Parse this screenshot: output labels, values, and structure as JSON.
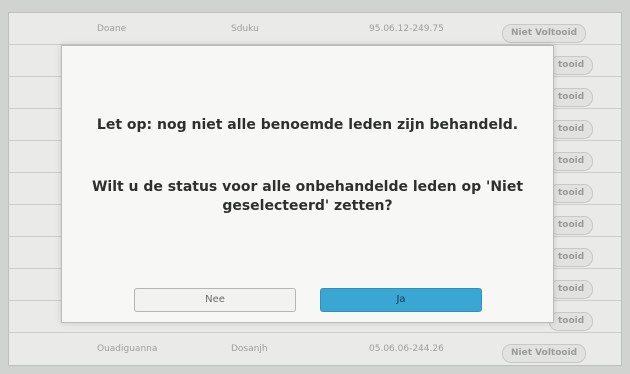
{
  "table": {
    "rows": [
      {
        "name": "Doane",
        "surname": "Sduku",
        "code": "95.06.12-249.75",
        "status": "Niet Voltooid"
      },
      {
        "name": "",
        "surname": "",
        "code": "",
        "status": "tooid"
      },
      {
        "name": "",
        "surname": "",
        "code": "",
        "status": "tooid"
      },
      {
        "name": "",
        "surname": "",
        "code": "",
        "status": "tooid"
      },
      {
        "name": "",
        "surname": "",
        "code": "",
        "status": "tooid"
      },
      {
        "name": "",
        "surname": "",
        "code": "",
        "status": "tooid"
      },
      {
        "name": "",
        "surname": "",
        "code": "",
        "status": "tooid"
      },
      {
        "name": "",
        "surname": "",
        "code": "",
        "status": "tooid"
      },
      {
        "name": "",
        "surname": "",
        "code": "",
        "status": "tooid"
      },
      {
        "name": "",
        "surname": "",
        "code": "",
        "status": "tooid"
      },
      {
        "name": "Ouadiguanna",
        "surname": "Dosanjh",
        "code": "05.06.06-244.26",
        "status": "Niet Voltooid"
      }
    ]
  },
  "dialog": {
    "message_line1": "Let op: nog niet alle benoemde leden zijn behandeld.",
    "message_line2": "Wilt u de status voor alle onbehandelde leden op 'Niet geselecteerd' zetten?",
    "no_label": "Nee",
    "yes_label": "Ja"
  }
}
